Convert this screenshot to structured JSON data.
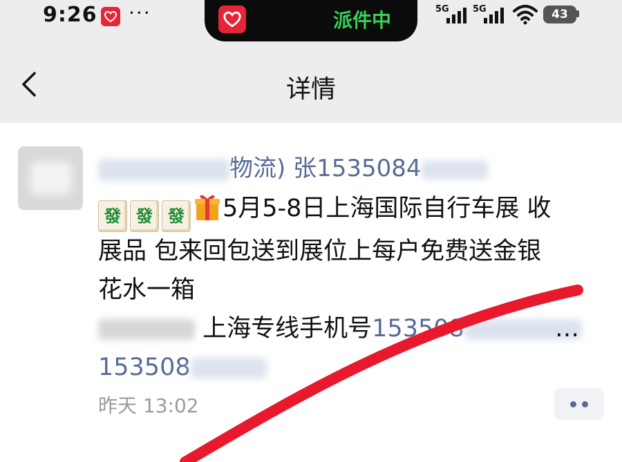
{
  "status_bar": {
    "time": "9:26",
    "dots": "···",
    "island_text": "派件中",
    "network_1": "5G",
    "network_2": "5G",
    "battery": "43",
    "app_badge_color": "#e52638",
    "island_text_color": "#37d25a"
  },
  "nav": {
    "title": "详情",
    "back_icon": "chevron-left-icon"
  },
  "message": {
    "sender_visible": "物流) 张1535084",
    "line1_text": "5月5-8日上海国际自行车展 收",
    "line2_text": "展品 包来回包送到展位上每户免费送金银",
    "line3_text": "花水一箱",
    "line4_text": "上海专线手机号",
    "line4_phone": "153508",
    "line4_suffix": "…",
    "line5_phone": "153508",
    "tile_glyph": "發",
    "time": "昨天 13:02",
    "more_icon": "more-dots-icon",
    "link_color": "#576b95"
  }
}
